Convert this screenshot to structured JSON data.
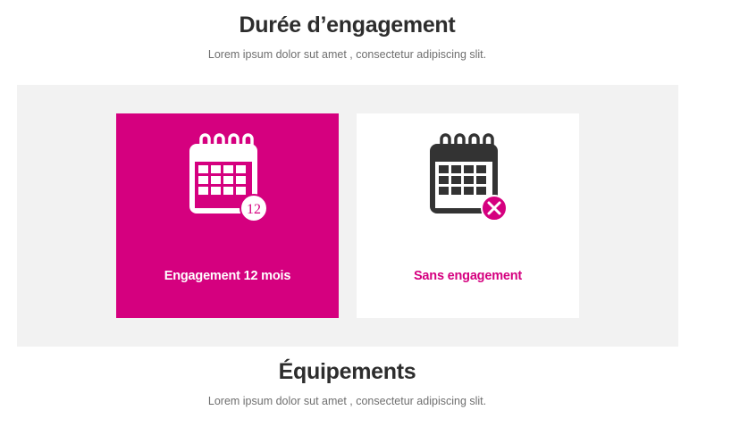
{
  "engagement": {
    "title": "Durée d’engagement",
    "subtitle": "Lorem ipsum dolor sut amet , consectetur adipiscing slit.",
    "options": [
      {
        "label": "Engagement 12 mois",
        "badge": "12",
        "selected": true,
        "icon": "calendar-12-icon"
      },
      {
        "label": "Sans engagement",
        "selected": false,
        "icon": "calendar-no-commitment-icon"
      }
    ]
  },
  "equipements": {
    "title": "Équipements",
    "subtitle": "Lorem ipsum dolor sut amet , consectetur adipiscing slit."
  },
  "colors": {
    "accent": "#d5007f",
    "panel_bg": "#f2f2f2",
    "text_dark": "#2d2d2d",
    "text_muted": "#6f6f6f"
  }
}
